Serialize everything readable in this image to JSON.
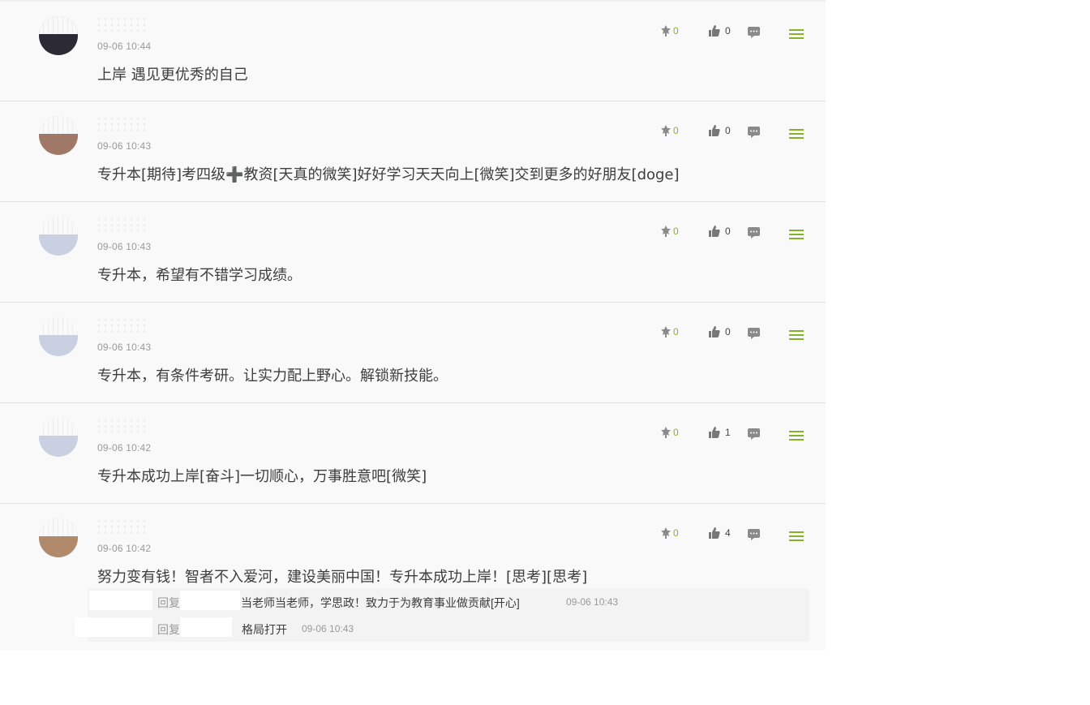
{
  "comments": [
    {
      "time": "09-06 10:44",
      "content": "上岸 遇见更优秀的自己",
      "reward": "0",
      "likes": "0",
      "avatar_color": "#2b2a35"
    },
    {
      "time": "09-06 10:43",
      "content": "专升本[期待]考四级➕教资[天真的微笑]好好学习天天向上[微笑]交到更多的好朋友[doge]",
      "reward": "0",
      "likes": "0",
      "avatar_color": "#a07868"
    },
    {
      "time": "09-06 10:43",
      "content": "专升本，希望有不错学习成绩。",
      "reward": "0",
      "likes": "0",
      "avatar_color": "#c9d0e2"
    },
    {
      "time": "09-06 10:43",
      "content": "专升本，有条件考研。让实力配上野心。解锁新技能。",
      "reward": "0",
      "likes": "0",
      "avatar_color": "#c9d0e2"
    },
    {
      "time": "09-06 10:42",
      "content": "专升本成功上岸[奋斗]一切顺心，万事胜意吧[微笑]",
      "reward": "0",
      "likes": "1",
      "avatar_color": "#c9d0e2"
    },
    {
      "time": "09-06 10:42",
      "content": "努力变有钱！智者不入爱河，建设美丽中国！专升本成功上岸！[思考][思考]",
      "reward": "0",
      "likes": "4",
      "avatar_color": "#b08a6a"
    }
  ],
  "replies": [
    {
      "reply_word": "回复",
      "text": "当老师当老师，学思政！致力于为教育事业做贡献[开心]",
      "time": "09-06 10:43"
    },
    {
      "reply_word": "回复",
      "text": "格局打开",
      "time": "09-06 10:43"
    }
  ],
  "icons": {
    "reward": "reward-icon",
    "like": "thumbs-up-icon",
    "reply": "comment-icon",
    "menu": "menu-icon"
  },
  "colors": {
    "accent": "#86b12a",
    "muted": "#9a9a9a",
    "text": "#3d3d3d"
  }
}
